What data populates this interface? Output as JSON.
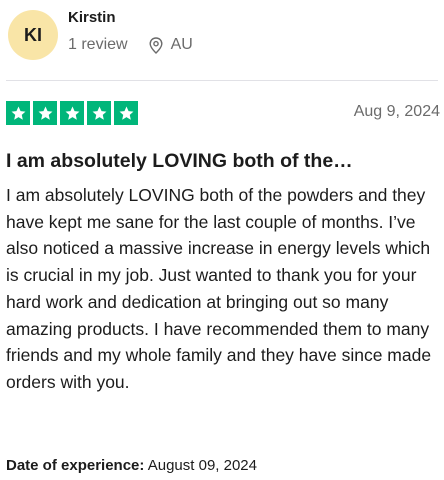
{
  "reviewer": {
    "initials": "KI",
    "name": "Kirstin",
    "review_count": "1 review",
    "location": "AU",
    "avatar_color": "#f9e5a7"
  },
  "review": {
    "rating": 5,
    "max_rating": 5,
    "star_color": "#00b67a",
    "date": "Aug 9, 2024",
    "title": "I am absolutely LOVING both of the…",
    "body": "I am absolutely LOVING both of the powders and they have kept me sane for the last couple of months. I’ve also noticed a massive increase in energy levels which is crucial in my job. Just wanted to thank you for your hard work and dedication at bringing out so many amazing products. I have recommended them to many friends and my whole family and they have since made orders with you.",
    "experience_label": "Date of experience:",
    "experience_date": "August 09, 2024"
  },
  "icons": {
    "location": "location-pin-icon",
    "star": "star-icon"
  }
}
